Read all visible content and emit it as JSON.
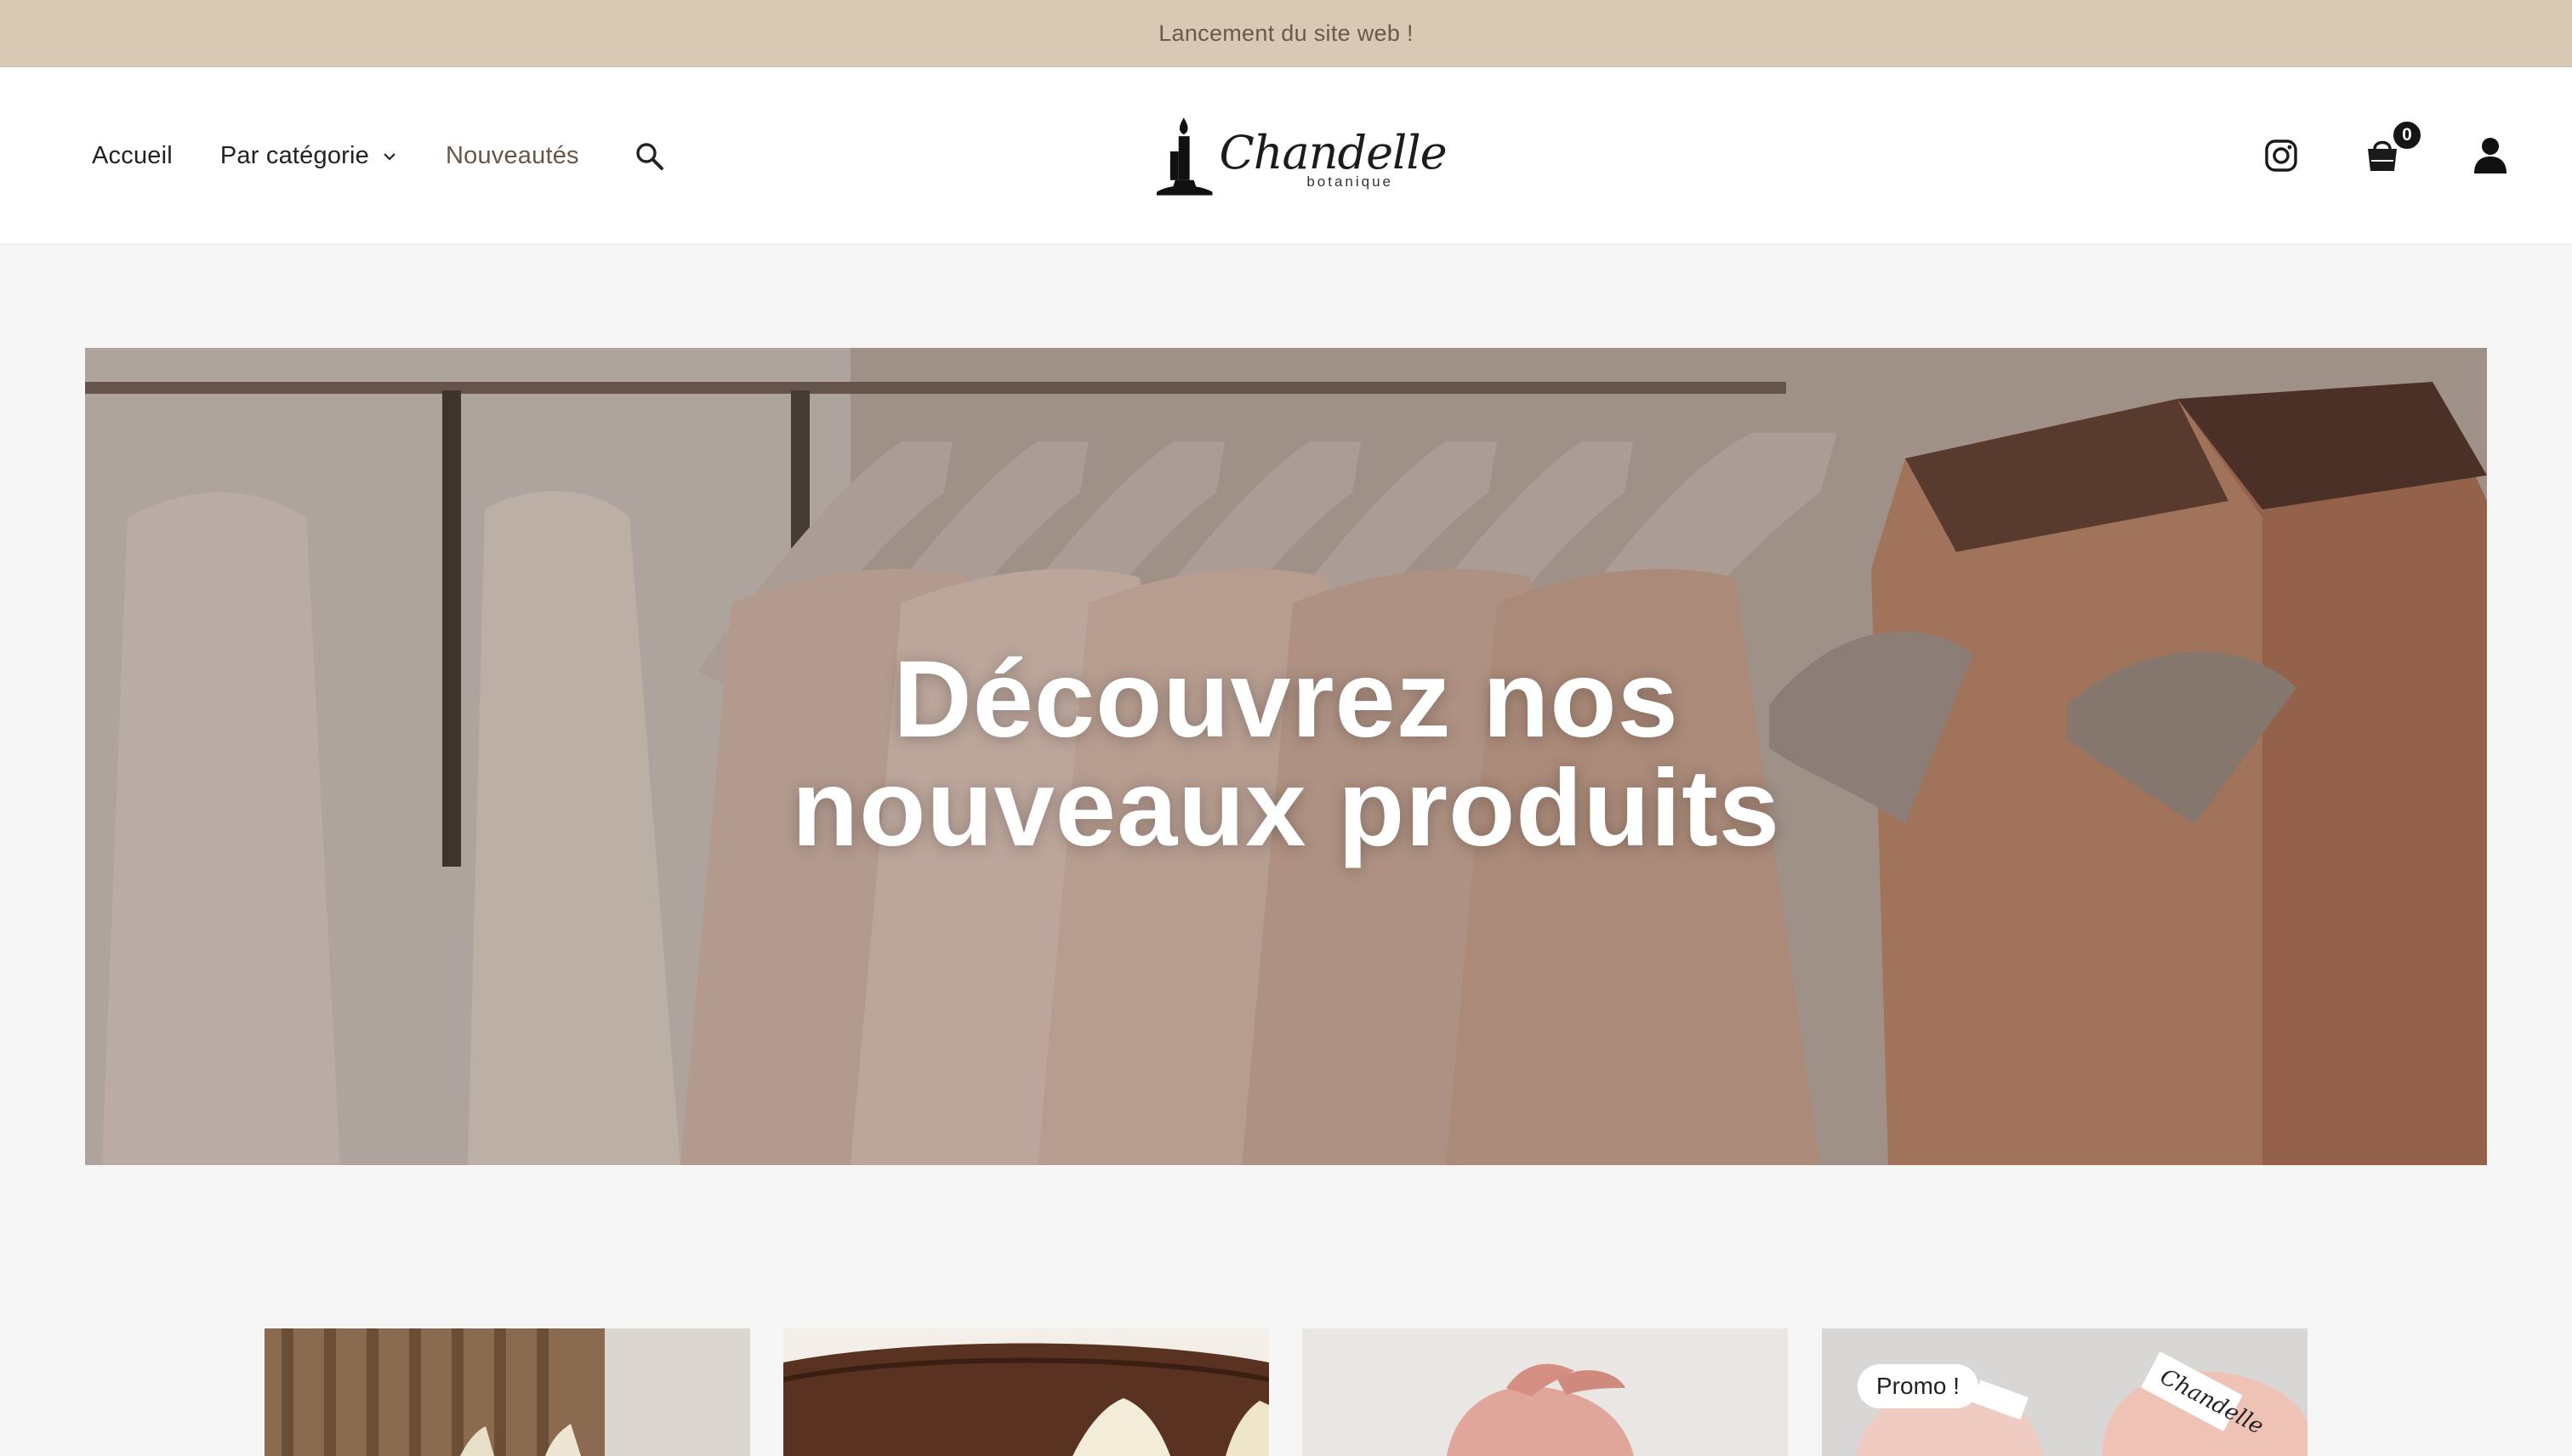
{
  "announcement": {
    "text": "Lancement du site web !"
  },
  "nav": {
    "items": [
      {
        "label": "Accueil"
      },
      {
        "label": "Par catégorie"
      },
      {
        "label": "Nouveautés"
      }
    ]
  },
  "logo": {
    "word": "Chandelle",
    "sub": "botanique"
  },
  "cart": {
    "count": "0"
  },
  "hero": {
    "line1": "Découvrez nos",
    "line2": "nouveaux produits"
  },
  "products": {
    "promo_label": "Promo !"
  },
  "colors": {
    "announcement_bg": "#d8c8b4",
    "accent": "#6b5646",
    "page_bg": "#f6f6f6"
  }
}
